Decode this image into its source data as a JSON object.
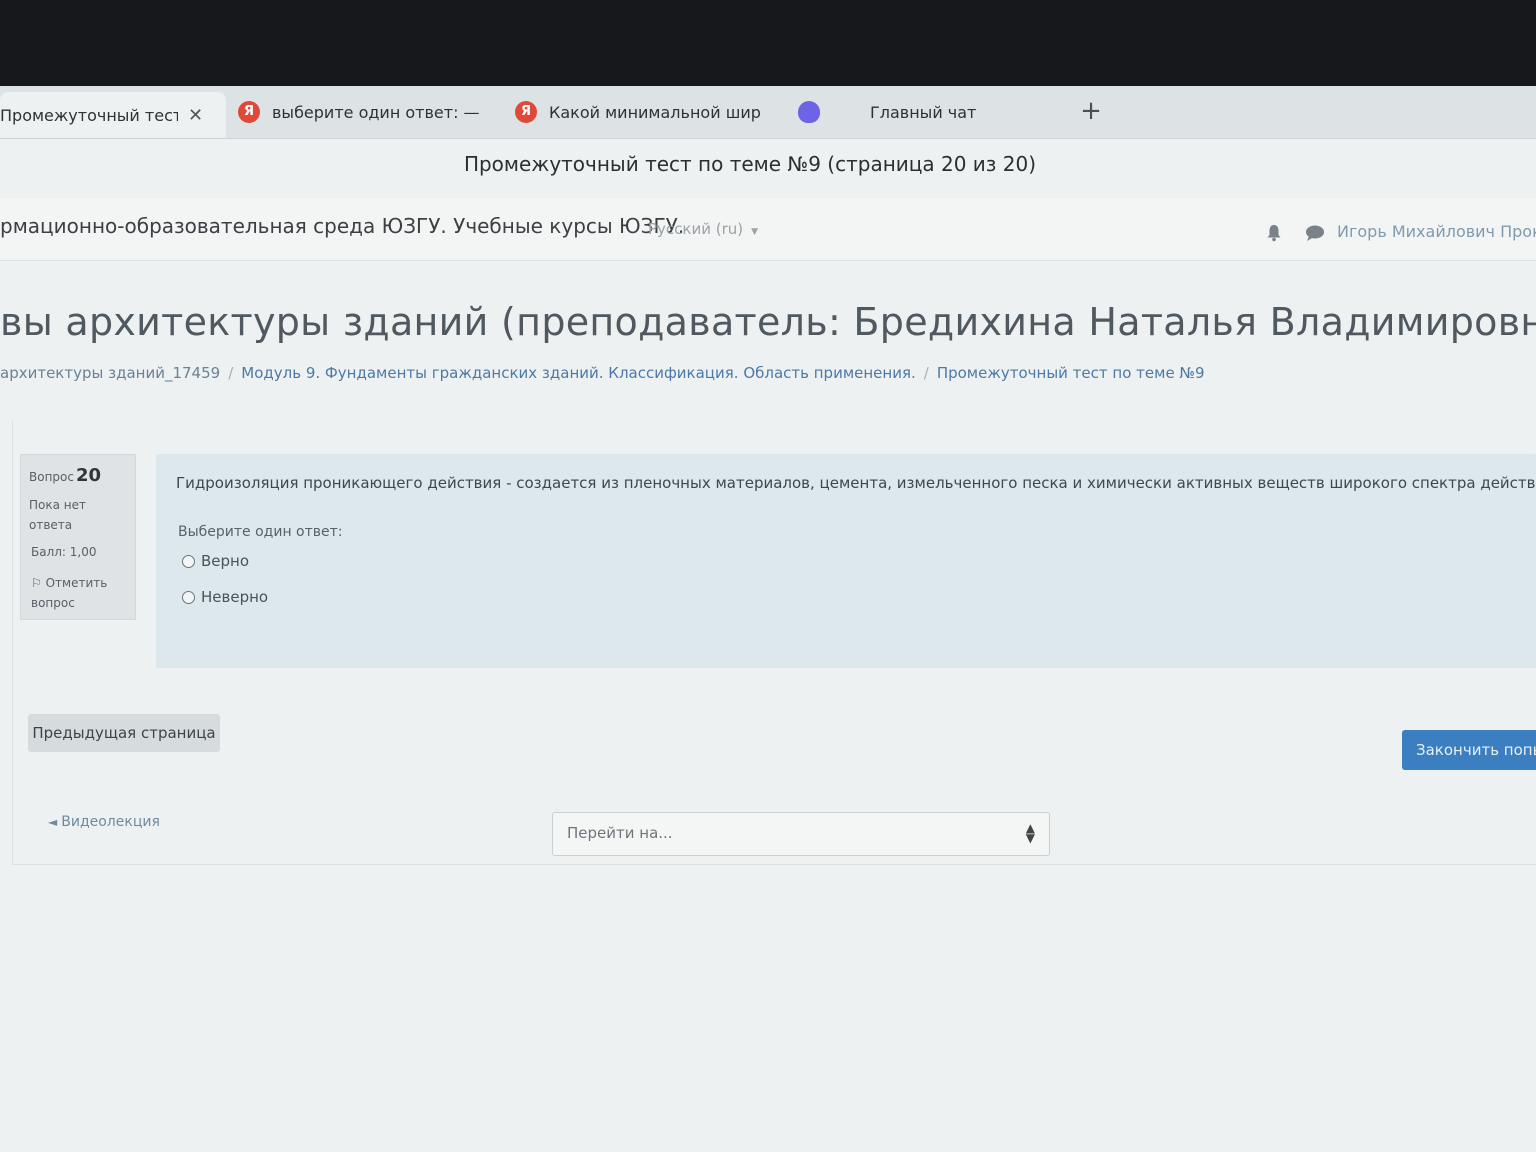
{
  "browser": {
    "tabs": [
      {
        "title": "Промежуточный тест",
        "icon": "none",
        "active": true,
        "has_close": true
      },
      {
        "title": "выберите один ответ: —",
        "icon": "yandex-icon"
      },
      {
        "title": "Какой минимальной шир",
        "icon": "yandex-icon"
      },
      {
        "title": "",
        "icon": "alice-icon"
      },
      {
        "title": "Главный чат",
        "icon": "none"
      }
    ],
    "new_tab_label": "+",
    "yandex_letter": "Я",
    "window_title": "Промежуточный тест по теме №9 (страница 20 из 20)"
  },
  "navbar": {
    "site_name": "рмационно-образовательная среда ЮЗГУ. Учебные курсы ЮЗГУ.",
    "language": "Русский (ru)",
    "user_name": "Игорь Михайлович Проку"
  },
  "header": {
    "course_title": "вы архитектуры зданий (преподаватель: Бредихина Наталья Владимировна)",
    "breadcrumb": [
      "архитектуры зданий_17459",
      "Модуль 9. Фундаменты гражданских зданий. Классификация. Область применения.",
      "Промежуточный тест по теме №9"
    ],
    "breadcrumb_sep": "/"
  },
  "question": {
    "label": "Вопрос",
    "number": "20",
    "state": "Пока нет ответа",
    "grade": "Балл: 1,00",
    "flag": "Отметить вопрос",
    "text": "Гидроизоляция проникающего действия - создается из пленочных материалов, цемента, измельченного песка и химически активных веществ широкого спектра действия",
    "prompt": "Выберите один ответ:",
    "answers": [
      "Верно",
      "Неверно"
    ]
  },
  "buttons": {
    "prev_page": "Предыдущая страница",
    "finish": "Закончить попы"
  },
  "footer": {
    "prev_activity": "Видеолекция",
    "jump_placeholder": "Перейти на..."
  },
  "colors": {
    "accent": "#3b7fc0",
    "question_bg": "#dce8ec",
    "link": "#4c79a6"
  }
}
